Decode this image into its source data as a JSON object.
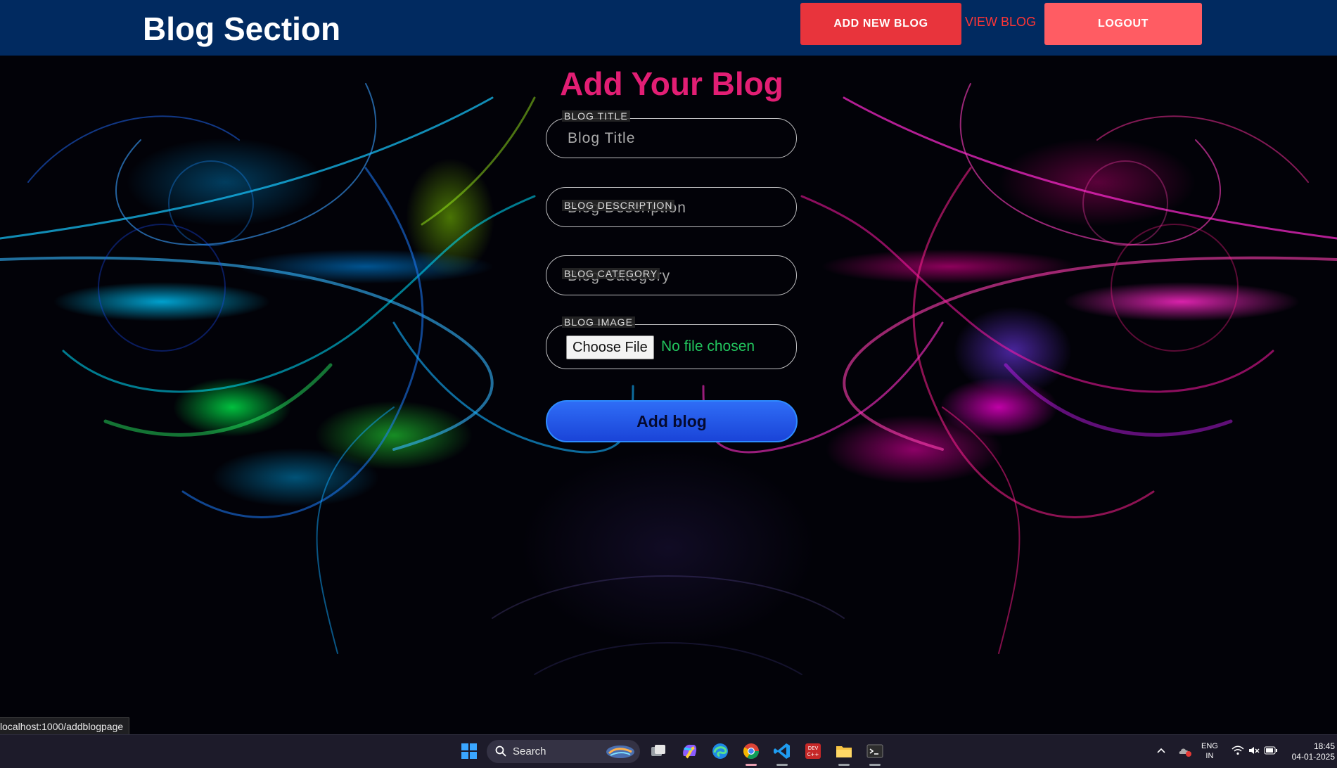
{
  "header": {
    "brand": "Blog Section",
    "nav_add": "ADD NEW BLOG",
    "nav_view": "VIEW BLOG",
    "nav_logout": "LOGOUT"
  },
  "form": {
    "title": "Add Your Blog",
    "fields": [
      {
        "label": "BLOG TITLE",
        "placeholder": "Blog Title"
      },
      {
        "label": "BLOG DESCRIPTION",
        "placeholder": "Blog Description"
      },
      {
        "label": "BLOG CATEGORY",
        "placeholder": "Blog Category"
      }
    ],
    "image_label": "BLOG IMAGE",
    "file_button": "Choose File",
    "file_status": "No file chosen",
    "submit": "Add blog"
  },
  "status_url": "localhost:1000/addblogpage",
  "taskbar": {
    "search_text": "Search",
    "lang_line1": "ENG",
    "lang_line2": "IN",
    "time": "18:45",
    "date": "04-01-2025",
    "icons": [
      "windows-start-icon",
      "search-icon",
      "task-view-icon",
      "copilot-icon",
      "edge-icon",
      "chrome-icon",
      "vscode-icon",
      "devcpp-icon",
      "file-explorer-icon",
      "terminal-icon"
    ]
  },
  "colors": {
    "nav_bg": "#012a60",
    "add_button": "#e8343c",
    "logout_button": "#ff5c63",
    "view_link": "#ff3535",
    "form_title": "#e21e74",
    "file_status": "#22c55e",
    "submit_button": "#2f6df6"
  }
}
